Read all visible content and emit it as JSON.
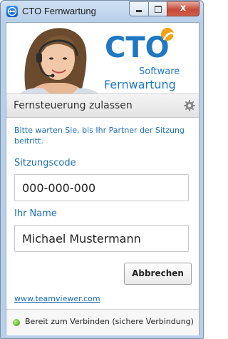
{
  "window": {
    "title": "CTO Fernwartung",
    "close_glyph": "x"
  },
  "banner": {
    "logo_text": "CTO",
    "logo_sub1": "Software",
    "logo_sub2": "Fernwartung",
    "colors": {
      "logo_blue": "#1f78c2",
      "logo_orange": "#f2a21a"
    }
  },
  "section": {
    "title": "Fernsteuerung zulassen",
    "settings_icon": "gear-icon"
  },
  "main": {
    "info_text": "Bitte warten Sie, bis Ihr Partner der Sitzung beitritt.",
    "session_code_label": "Sitzungscode",
    "session_code_value": "000-000-000",
    "name_label": "Ihr Name",
    "name_value": "Michael Mustermann",
    "cancel_label": "Abbrechen",
    "link_text": "www.teamviewer.com"
  },
  "status": {
    "text": "Bereit zum Verbinden (sichere Verbindung)",
    "color": "#5cb32a"
  }
}
